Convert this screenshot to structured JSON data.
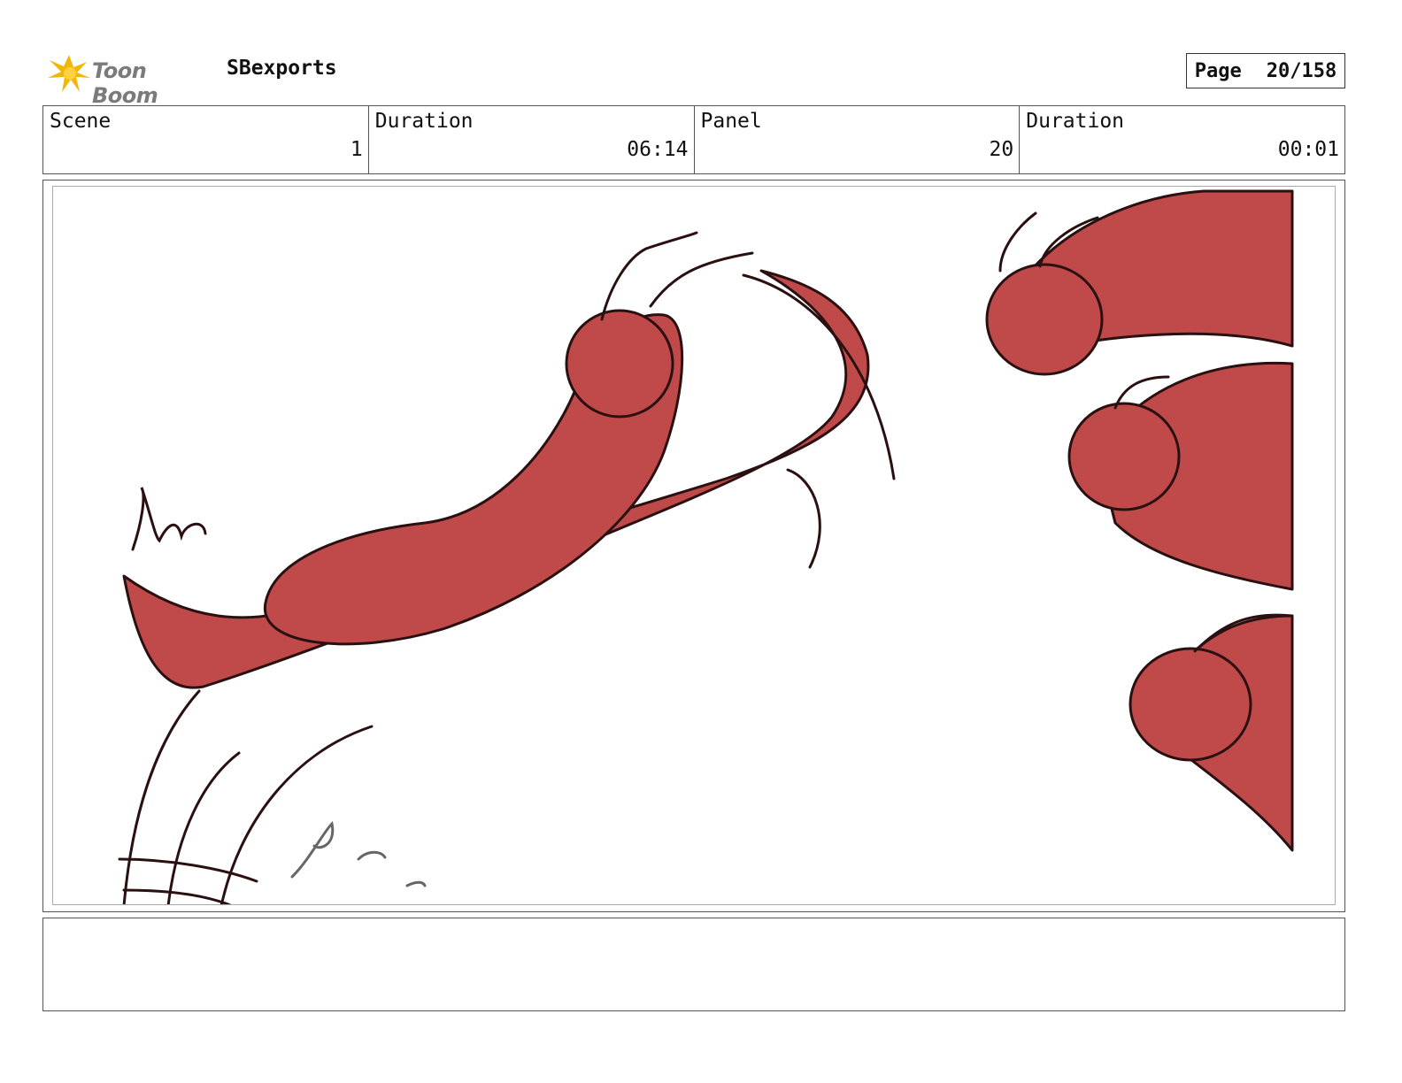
{
  "header": {
    "logo_text": "Toon Boom",
    "project_name": "SBexports",
    "page_label": "Page",
    "page_value": "20/158"
  },
  "info": [
    {
      "label": "Scene",
      "value": "1"
    },
    {
      "label": "Duration",
      "value": "06:14"
    },
    {
      "label": "Panel",
      "value": "20"
    },
    {
      "label": "Duration",
      "value": "00:01"
    }
  ],
  "notes": {
    "text": ""
  },
  "colors": {
    "fill": "#c04a4a",
    "line": "#2a1010",
    "logo_accent": "#f2b705"
  }
}
